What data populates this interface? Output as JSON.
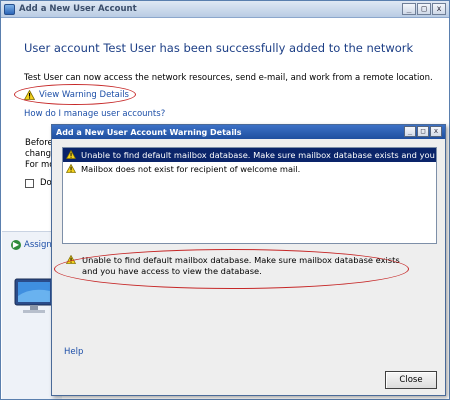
{
  "main_window": {
    "title": "Add a New User Account",
    "title_buttons": [
      "_",
      "□",
      "x"
    ],
    "headline": "User account Test User has been successfully added to the network",
    "description": "Test User can now access the network resources, send e-mail, and work from a remote location.",
    "warning_link": "View Warning Details",
    "manage_link": "How do I manage user accounts?",
    "partial_text_lines": [
      "Before",
      "change",
      "For mc"
    ],
    "checkbox_label": "Do",
    "assign_label": "Assign"
  },
  "warning_dialog": {
    "title": "Add a New User Account Warning Details",
    "title_buttons": [
      "_",
      "□",
      "x"
    ],
    "warnings": [
      {
        "text": "Unable to find default mailbox database. Make sure mailbox database exists and you ha...",
        "selected": true
      },
      {
        "text": "Mailbox does not exist for recipient of welcome mail.",
        "selected": false
      }
    ],
    "detail_text": "Unable to find default mailbox database. Make sure mailbox database exists and you have access to view the database.",
    "help_label": "Help",
    "close_label": "Close"
  },
  "icons": {
    "warning": "warning-triangle-icon",
    "assign": "green-arrow-icon",
    "app": "user-accounts-app-icon"
  },
  "colors": {
    "annotation_ellipse": "#c62828",
    "selection": "#0a246a",
    "link": "#1d4fa8",
    "headline": "#1d3f86"
  }
}
